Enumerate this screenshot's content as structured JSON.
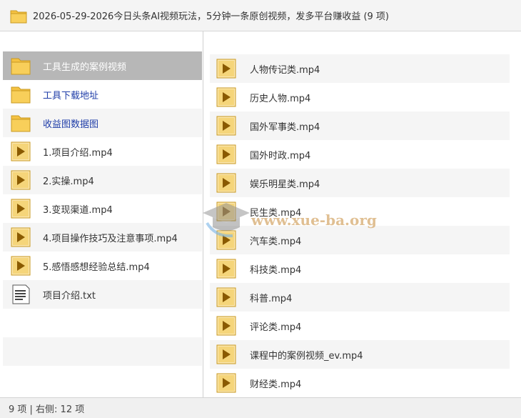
{
  "window": {
    "title": "2026-05-29-2026今日头条AI视频玩法，5分钟一条原创视频，发多平台赚收益 (9 项)"
  },
  "left_panel": {
    "items": [
      {
        "label": "工具生成的案例视频",
        "icon": "folder-icon",
        "selected": true
      },
      {
        "label": "工具下载地址",
        "icon": "folder-icon"
      },
      {
        "label": "收益图数据图",
        "icon": "folder-icon"
      },
      {
        "label": "1.项目介绍.mp4",
        "icon": "video-file-icon"
      },
      {
        "label": "2.实操.mp4",
        "icon": "video-file-icon"
      },
      {
        "label": "3.变现渠道.mp4",
        "icon": "video-file-icon"
      },
      {
        "label": "4.项目操作技巧及注意事项.mp4",
        "icon": "video-file-icon"
      },
      {
        "label": "5.感悟感想经验总结.mp4",
        "icon": "video-file-icon"
      },
      {
        "label": "项目介绍.txt",
        "icon": "text-file-icon"
      }
    ]
  },
  "right_panel": {
    "items": [
      {
        "label": "人物传记类.mp4",
        "icon": "video-file-icon"
      },
      {
        "label": "历史人物.mp4",
        "icon": "video-file-icon"
      },
      {
        "label": "国外军事类.mp4",
        "icon": "video-file-icon"
      },
      {
        "label": "国外时政.mp4",
        "icon": "video-file-icon"
      },
      {
        "label": "娱乐明星类.mp4",
        "icon": "video-file-icon"
      },
      {
        "label": "民生类.mp4",
        "icon": "video-file-icon"
      },
      {
        "label": "汽车类.mp4",
        "icon": "video-file-icon"
      },
      {
        "label": "科技类.mp4",
        "icon": "video-file-icon"
      },
      {
        "label": "科普.mp4",
        "icon": "video-file-icon"
      },
      {
        "label": "评论类.mp4",
        "icon": "video-file-icon"
      },
      {
        "label": "课程中的案例视频_ev.mp4",
        "icon": "video-file-icon"
      },
      {
        "label": "财经类.mp4",
        "icon": "video-file-icon"
      }
    ]
  },
  "status": {
    "text": "9 项 | 右侧: 12 项"
  },
  "watermark": {
    "text": "www.xue-ba.org"
  },
  "colors": {
    "folder": "#f5c242",
    "video_icon": "#f0b63a",
    "folder_text": "#1f3da8",
    "selected_row": "#b7b7b7"
  }
}
